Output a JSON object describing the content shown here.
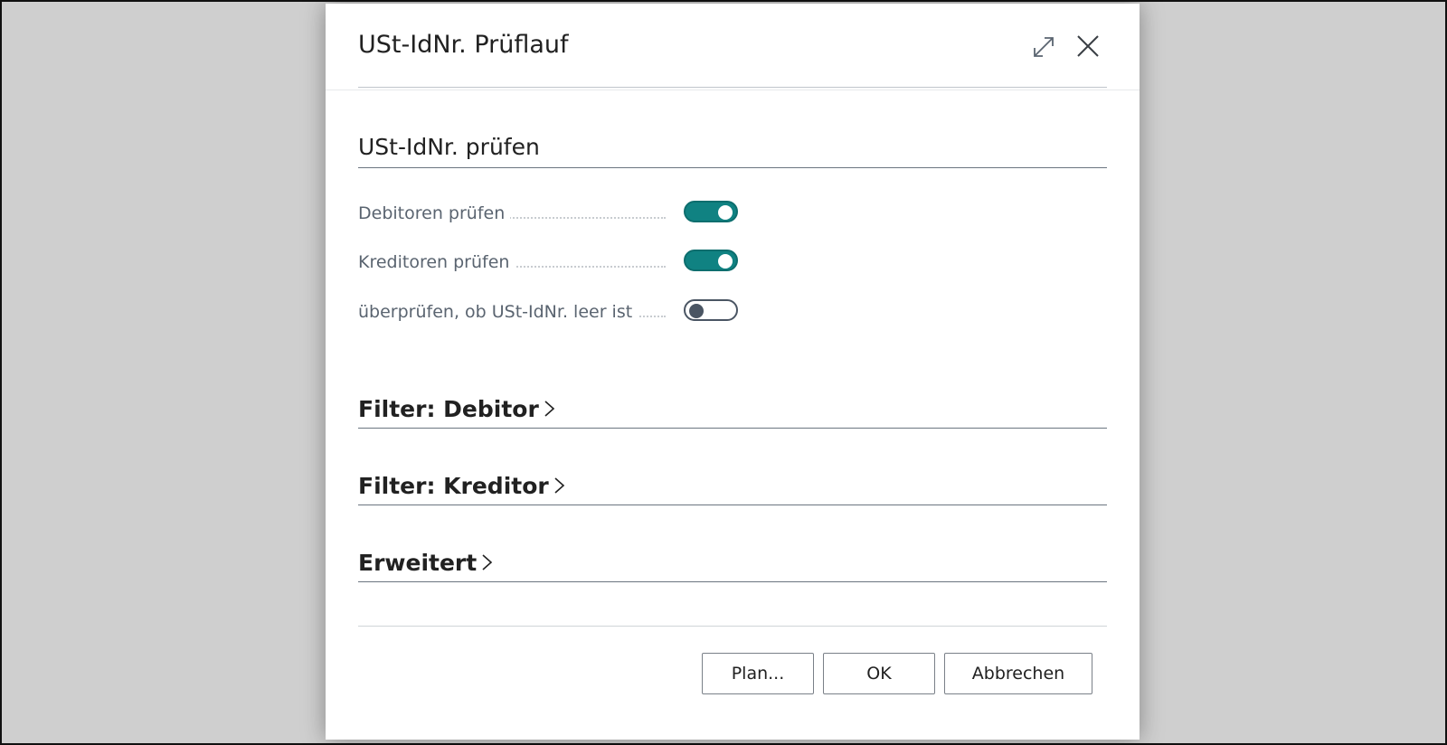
{
  "dialog": {
    "title": "USt-IdNr. Prüflauf",
    "expand_icon": "expand-icon",
    "close_icon": "close-icon"
  },
  "section": {
    "title": "USt-IdNr. prüfen",
    "fields": [
      {
        "label": "Debitoren prüfen",
        "value": true
      },
      {
        "label": "Kreditoren prüfen",
        "value": true
      },
      {
        "label": "überprüfen, ob USt-IdNr. leer ist",
        "value": false
      }
    ]
  },
  "fasttabs": [
    {
      "label": "Filter: Debitor"
    },
    {
      "label": "Filter: Kreditor"
    },
    {
      "label": "Erweitert"
    }
  ],
  "buttons": {
    "plan": "Plan...",
    "ok": "OK",
    "cancel": "Abbrechen"
  },
  "colors": {
    "toggle_on": "#108282",
    "toggle_off_border": "#4a5563",
    "overlay": "#cfcfcf"
  }
}
